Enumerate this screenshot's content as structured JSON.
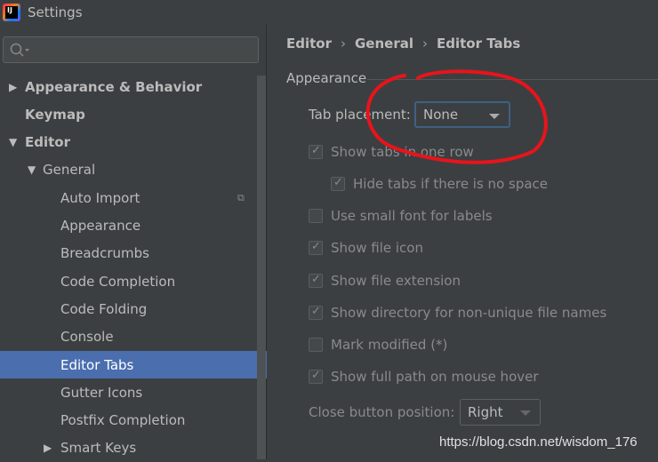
{
  "window": {
    "title": "Settings",
    "logo_text": "IJ"
  },
  "search": {
    "placeholder": "",
    "icon": "search-icon"
  },
  "sidebar": {
    "items": [
      {
        "label": "Appearance & Behavior",
        "level": 0,
        "arrow": "right",
        "bold": true
      },
      {
        "label": "Keymap",
        "level": 0,
        "arrow": "",
        "bold": true
      },
      {
        "label": "Editor",
        "level": 0,
        "arrow": "down",
        "bold": true
      },
      {
        "label": "General",
        "level": 1,
        "arrow": "down",
        "bold": false
      },
      {
        "label": "Auto Import",
        "level": 2,
        "arrow": "",
        "bold": false,
        "copy_icon": true
      },
      {
        "label": "Appearance",
        "level": 2,
        "arrow": "",
        "bold": false
      },
      {
        "label": "Breadcrumbs",
        "level": 2,
        "arrow": "",
        "bold": false
      },
      {
        "label": "Code Completion",
        "level": 2,
        "arrow": "",
        "bold": false
      },
      {
        "label": "Code Folding",
        "level": 2,
        "arrow": "",
        "bold": false
      },
      {
        "label": "Console",
        "level": 2,
        "arrow": "",
        "bold": false
      },
      {
        "label": "Editor Tabs",
        "level": 2,
        "arrow": "",
        "bold": false,
        "selected": true
      },
      {
        "label": "Gutter Icons",
        "level": 2,
        "arrow": "",
        "bold": false
      },
      {
        "label": "Postfix Completion",
        "level": 2,
        "arrow": "",
        "bold": false
      },
      {
        "label": "Smart Keys",
        "level": 2,
        "arrow": "right",
        "bold": false
      }
    ]
  },
  "breadcrumb": [
    "Editor",
    "General",
    "Editor Tabs"
  ],
  "breadcrumb_separator": "›",
  "appearance": {
    "group_title": "Appearance",
    "tab_placement_label": "Tab placement:",
    "tab_placement_value": "None",
    "options": [
      {
        "label": "Show tabs in one row",
        "checked": true,
        "disabled": true,
        "indent": false
      },
      {
        "label": "Hide tabs if there is no space",
        "checked": true,
        "disabled": true,
        "indent": true
      },
      {
        "label": "Use small font for labels",
        "checked": false,
        "disabled": true,
        "indent": false
      },
      {
        "label": "Show file icon",
        "checked": true,
        "disabled": true,
        "indent": false
      },
      {
        "label": "Show file extension",
        "checked": true,
        "disabled": true,
        "indent": false
      },
      {
        "label": "Show directory for non-unique file names",
        "checked": true,
        "disabled": true,
        "indent": false
      },
      {
        "label": "Mark modified (*)",
        "checked": false,
        "disabled": true,
        "indent": false
      },
      {
        "label": "Show full path on mouse hover",
        "checked": true,
        "disabled": true,
        "indent": false
      }
    ],
    "close_button_label": "Close button position:",
    "close_button_value": "Right"
  },
  "watermark": "https://blog.csdn.net/wisdom_176",
  "colors": {
    "selection": "#4b6eaf",
    "focus_border": "#3d6185",
    "annotation": "#e8141b"
  }
}
